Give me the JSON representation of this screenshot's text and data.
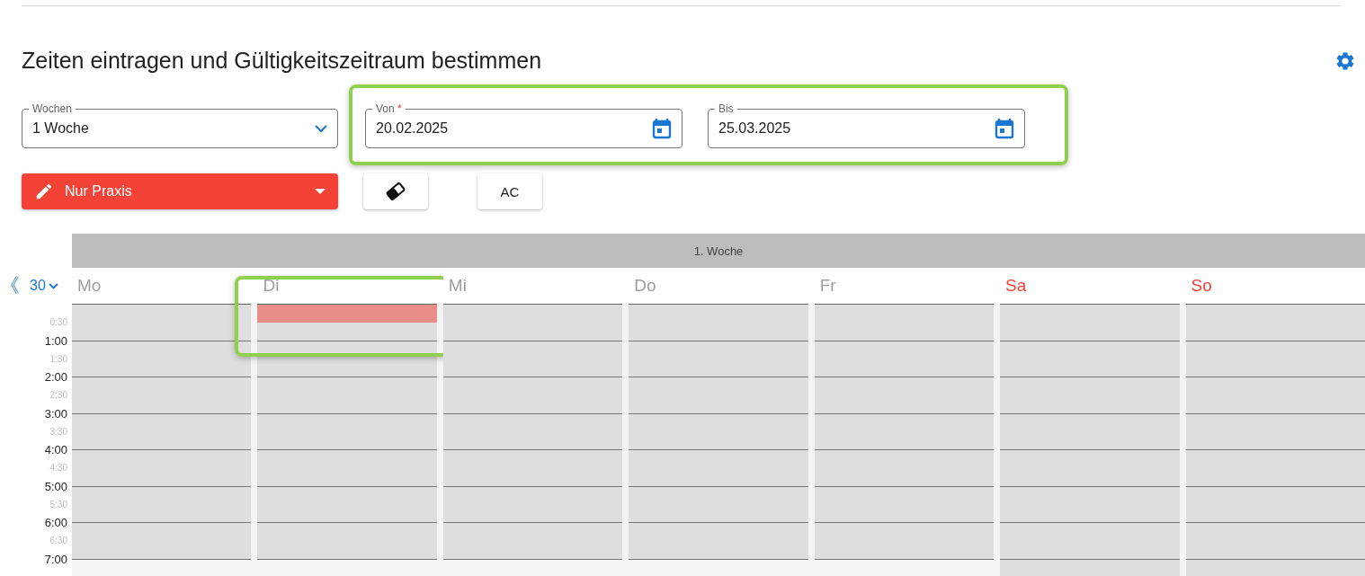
{
  "title": "Zeiten eintragen und Gültigkeitszeitraum bestimmen",
  "weeks_select": {
    "label": "Wochen",
    "value": "1 Woche"
  },
  "date_range": {
    "highlighted": true,
    "fields": [
      {
        "label": "Von",
        "required_mark": "*",
        "value": "20.02.2025"
      },
      {
        "label": "Bis",
        "value": "25.03.2025"
      }
    ]
  },
  "mode_button": {
    "label": "Nur Praxis"
  },
  "ac_button": {
    "label": "AC"
  },
  "calendar": {
    "week_label": "1. Woche",
    "back_symbol": "《",
    "interval": "30",
    "times": [
      {
        "label": "0:30",
        "kind": "half"
      },
      {
        "label": "1:00",
        "kind": "hour"
      },
      {
        "label": "1:30",
        "kind": "half"
      },
      {
        "label": "2:00",
        "kind": "hour"
      },
      {
        "label": "2:30",
        "kind": "half"
      },
      {
        "label": "3:00",
        "kind": "hour"
      },
      {
        "label": "3:30",
        "kind": "half"
      },
      {
        "label": "4:00",
        "kind": "hour"
      },
      {
        "label": "4:30",
        "kind": "half"
      },
      {
        "label": "5:00",
        "kind": "hour"
      },
      {
        "label": "5:30",
        "kind": "half"
      },
      {
        "label": "6:00",
        "kind": "hour"
      },
      {
        "label": "6:30",
        "kind": "half"
      },
      {
        "label": "7:00",
        "kind": "hour"
      }
    ],
    "days": [
      {
        "label": "Mo",
        "weekend": false,
        "highlighted": false,
        "slots": [
          {
            "marked": false,
            "available": true
          },
          {
            "marked": false,
            "available": true
          },
          {
            "marked": false,
            "available": true
          },
          {
            "marked": false,
            "available": true
          },
          {
            "marked": false,
            "available": true
          },
          {
            "marked": false,
            "available": true
          },
          {
            "marked": false,
            "available": true
          },
          {
            "marked": false,
            "available": true
          },
          {
            "marked": false,
            "available": true
          },
          {
            "marked": false,
            "available": true
          },
          {
            "marked": false,
            "available": true
          },
          {
            "marked": false,
            "available": true
          },
          {
            "marked": false,
            "available": true
          },
          {
            "marked": false,
            "available": true
          },
          {
            "marked": false,
            "available": false
          }
        ]
      },
      {
        "label": "Di",
        "weekend": false,
        "highlighted": true,
        "slots": [
          {
            "marked": true,
            "available": true
          },
          {
            "marked": false,
            "available": true
          },
          {
            "marked": false,
            "available": true
          },
          {
            "marked": false,
            "available": true
          },
          {
            "marked": false,
            "available": true
          },
          {
            "marked": false,
            "available": true
          },
          {
            "marked": false,
            "available": true
          },
          {
            "marked": false,
            "available": true
          },
          {
            "marked": false,
            "available": true
          },
          {
            "marked": false,
            "available": true
          },
          {
            "marked": false,
            "available": true
          },
          {
            "marked": false,
            "available": true
          },
          {
            "marked": false,
            "available": true
          },
          {
            "marked": false,
            "available": true
          },
          {
            "marked": false,
            "available": false
          }
        ]
      },
      {
        "label": "Mi",
        "weekend": false,
        "highlighted": false,
        "slots": [
          {
            "marked": false,
            "available": true
          },
          {
            "marked": false,
            "available": true
          },
          {
            "marked": false,
            "available": true
          },
          {
            "marked": false,
            "available": true
          },
          {
            "marked": false,
            "available": true
          },
          {
            "marked": false,
            "available": true
          },
          {
            "marked": false,
            "available": true
          },
          {
            "marked": false,
            "available": true
          },
          {
            "marked": false,
            "available": true
          },
          {
            "marked": false,
            "available": true
          },
          {
            "marked": false,
            "available": true
          },
          {
            "marked": false,
            "available": true
          },
          {
            "marked": false,
            "available": true
          },
          {
            "marked": false,
            "available": true
          },
          {
            "marked": false,
            "available": false
          }
        ]
      },
      {
        "label": "Do",
        "weekend": false,
        "highlighted": false,
        "slots": [
          {
            "marked": false,
            "available": true
          },
          {
            "marked": false,
            "available": true
          },
          {
            "marked": false,
            "available": true
          },
          {
            "marked": false,
            "available": true
          },
          {
            "marked": false,
            "available": true
          },
          {
            "marked": false,
            "available": true
          },
          {
            "marked": false,
            "available": true
          },
          {
            "marked": false,
            "available": true
          },
          {
            "marked": false,
            "available": true
          },
          {
            "marked": false,
            "available": true
          },
          {
            "marked": false,
            "available": true
          },
          {
            "marked": false,
            "available": true
          },
          {
            "marked": false,
            "available": true
          },
          {
            "marked": false,
            "available": true
          },
          {
            "marked": false,
            "available": false
          }
        ]
      },
      {
        "label": "Fr",
        "weekend": false,
        "highlighted": false,
        "slots": [
          {
            "marked": false,
            "available": true
          },
          {
            "marked": false,
            "available": true
          },
          {
            "marked": false,
            "available": true
          },
          {
            "marked": false,
            "available": true
          },
          {
            "marked": false,
            "available": true
          },
          {
            "marked": false,
            "available": true
          },
          {
            "marked": false,
            "available": true
          },
          {
            "marked": false,
            "available": true
          },
          {
            "marked": false,
            "available": true
          },
          {
            "marked": false,
            "available": true
          },
          {
            "marked": false,
            "available": true
          },
          {
            "marked": false,
            "available": true
          },
          {
            "marked": false,
            "available": true
          },
          {
            "marked": false,
            "available": true
          },
          {
            "marked": false,
            "available": false
          }
        ]
      },
      {
        "label": "Sa",
        "weekend": true,
        "highlighted": false,
        "slots": [
          {
            "marked": false,
            "available": true
          },
          {
            "marked": false,
            "available": true
          },
          {
            "marked": false,
            "available": true
          },
          {
            "marked": false,
            "available": true
          },
          {
            "marked": false,
            "available": true
          },
          {
            "marked": false,
            "available": true
          },
          {
            "marked": false,
            "available": true
          },
          {
            "marked": false,
            "available": true
          },
          {
            "marked": false,
            "available": true
          },
          {
            "marked": false,
            "available": true
          },
          {
            "marked": false,
            "available": true
          },
          {
            "marked": false,
            "available": true
          },
          {
            "marked": false,
            "available": true
          },
          {
            "marked": false,
            "available": true
          },
          {
            "marked": false,
            "available": true
          }
        ]
      },
      {
        "label": "So",
        "weekend": true,
        "highlighted": false,
        "slots": [
          {
            "marked": false,
            "available": true
          },
          {
            "marked": false,
            "available": true
          },
          {
            "marked": false,
            "available": true
          },
          {
            "marked": false,
            "available": true
          },
          {
            "marked": false,
            "available": true
          },
          {
            "marked": false,
            "available": true
          },
          {
            "marked": false,
            "available": true
          },
          {
            "marked": false,
            "available": true
          },
          {
            "marked": false,
            "available": true
          },
          {
            "marked": false,
            "available": true
          },
          {
            "marked": false,
            "available": true
          },
          {
            "marked": false,
            "available": true
          },
          {
            "marked": false,
            "available": true
          },
          {
            "marked": false,
            "available": true
          },
          {
            "marked": false,
            "available": true
          }
        ]
      }
    ]
  }
}
